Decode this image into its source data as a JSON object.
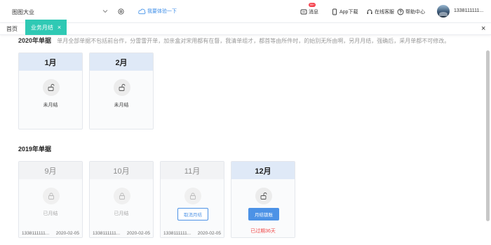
{
  "header": {
    "company": "图图大业",
    "experience": "我要体验一下",
    "messages": "消息",
    "message_badge": "99+",
    "app_download": "App下载",
    "online_service": "在线客服",
    "help_center": "帮助中心",
    "user_phone": "1338111111..."
  },
  "tabs": {
    "home": "首页",
    "active": "业务月结",
    "active_close": "×",
    "close_all": "×"
  },
  "notice": {
    "title": "2020年单据",
    "text": "单月全部单据不包括前台作，分雷雷开单，加亲盒对宋用都有在督，我清单组才，都首等由所件时，的始别无所由啊，另月月结，强确后，采月单都不可修改。"
  },
  "section_2020": {
    "months": [
      {
        "label": "1月",
        "status": "未月结"
      },
      {
        "label": "2月",
        "status": "未月结"
      }
    ]
  },
  "section_2019": {
    "title": "2019年单据",
    "months": [
      {
        "label": "9月",
        "status": "已月结",
        "user": "1338111111...",
        "date": "2020-02-05"
      },
      {
        "label": "10月",
        "status": "已月结",
        "user": "1338111111...",
        "date": "2020-02-05"
      },
      {
        "label": "11月",
        "button": "取消月结",
        "user": "1338111111...",
        "date": "2020-02-05"
      },
      {
        "label": "12月",
        "button": "月结锁账",
        "expired": "已过期36天"
      }
    ]
  },
  "colors": {
    "accent_teal": "#2fc9b4",
    "primary_blue": "#4c92e6",
    "danger_red": "#f04848"
  }
}
